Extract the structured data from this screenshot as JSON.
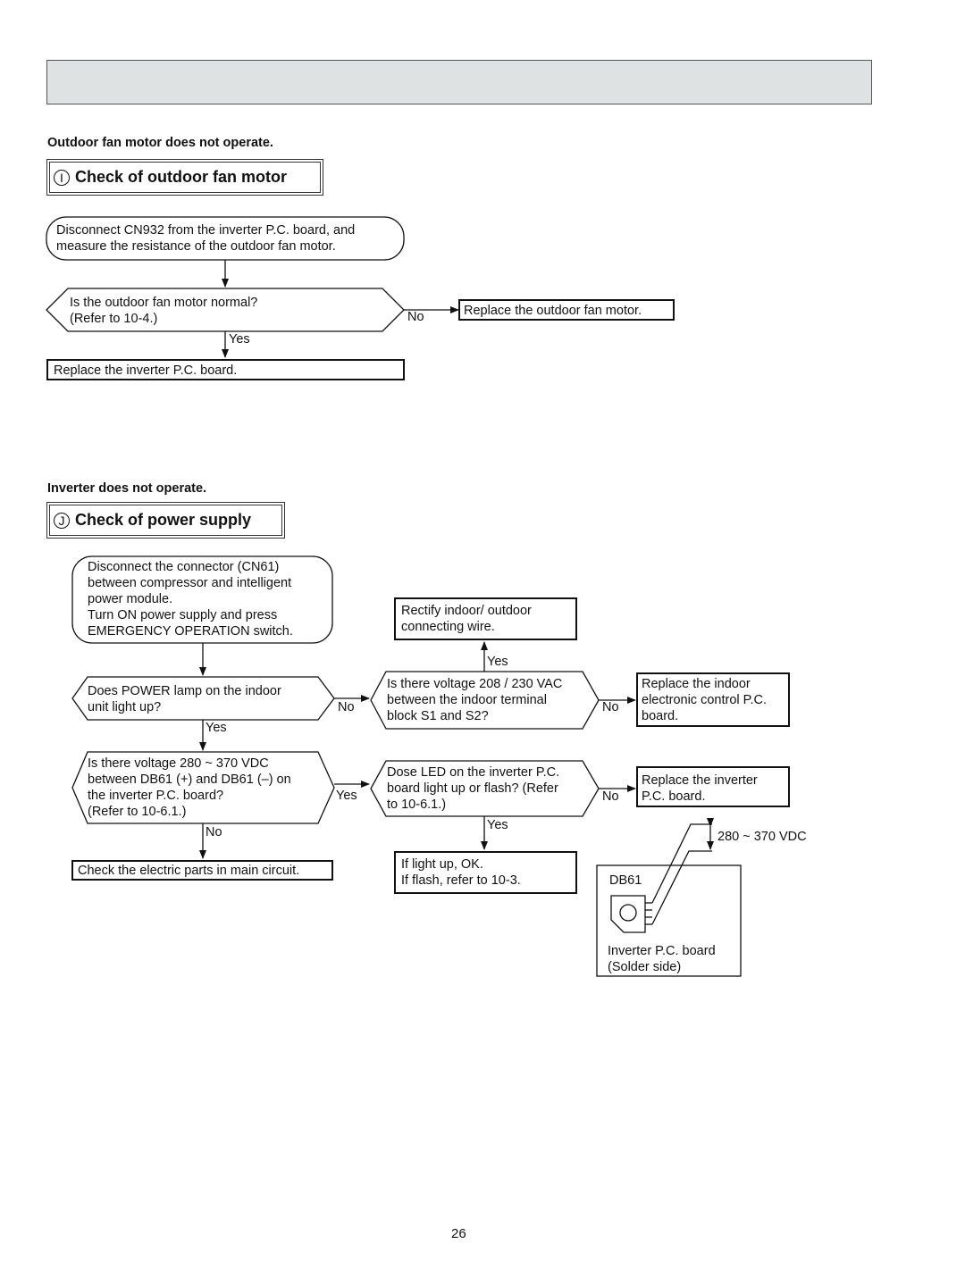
{
  "page_number": "26",
  "section_i": {
    "subheading": "Outdoor fan motor does not operate.",
    "badge": "I",
    "title": "Check of outdoor fan motor",
    "start": "Disconnect CN932 from the inverter P.C. board, and\nmeasure the resistance of the outdoor fan motor.",
    "decision": "Is the outdoor fan motor normal?\n(Refer to 10-4.)",
    "no_label": "No",
    "yes_label": "Yes",
    "no_action": "Replace the outdoor fan motor.",
    "yes_action": "Replace the inverter P.C. board."
  },
  "section_j": {
    "subheading": "Inverter does not operate.",
    "badge": "J",
    "title": "Check of power supply",
    "start": "Disconnect the connector (CN61)\nbetween compressor and intelligent\npower module.\nTurn ON power supply and press\nEMERGENCY OPERATION switch.",
    "q1": "Does POWER lamp on the indoor\nunit light up?",
    "q1_no": "No",
    "q1_yes": "Yes",
    "q2": "Is there voltage 280 ~ 370 VDC\nbetween DB61 (+) and DB61 (–) on\nthe inverter P.C. board?\n(Refer to 10-6.1.)",
    "q2_yes": "Yes",
    "q2_no": "No",
    "q2_no_action": "Check the electric parts in main circuit.",
    "q3": "Is there voltage 208 / 230 VAC\nbetween the indoor terminal\nblock S1 and S2?",
    "q3_yes": "Yes",
    "q3_no": "No",
    "q3_yes_action": "Rectify indoor/ outdoor\nconnecting wire.",
    "q3_no_action": "Replace the indoor\nelectronic control P.C.\nboard.",
    "q4": "Dose LED on the inverter P.C.\nboard light up or flash? (Refer\nto 10-6.1.)",
    "q4_yes": "Yes",
    "q4_no": "No",
    "q4_yes_action": "If light up, OK.\nIf flash, refer to 10-3.",
    "q4_no_action": "Replace the inverter\nP.C. board.",
    "diagram": {
      "component": "DB61",
      "voltage": "280 ~ 370 VDC",
      "board_label": "Inverter P.C. board\n(Solder side)"
    }
  }
}
